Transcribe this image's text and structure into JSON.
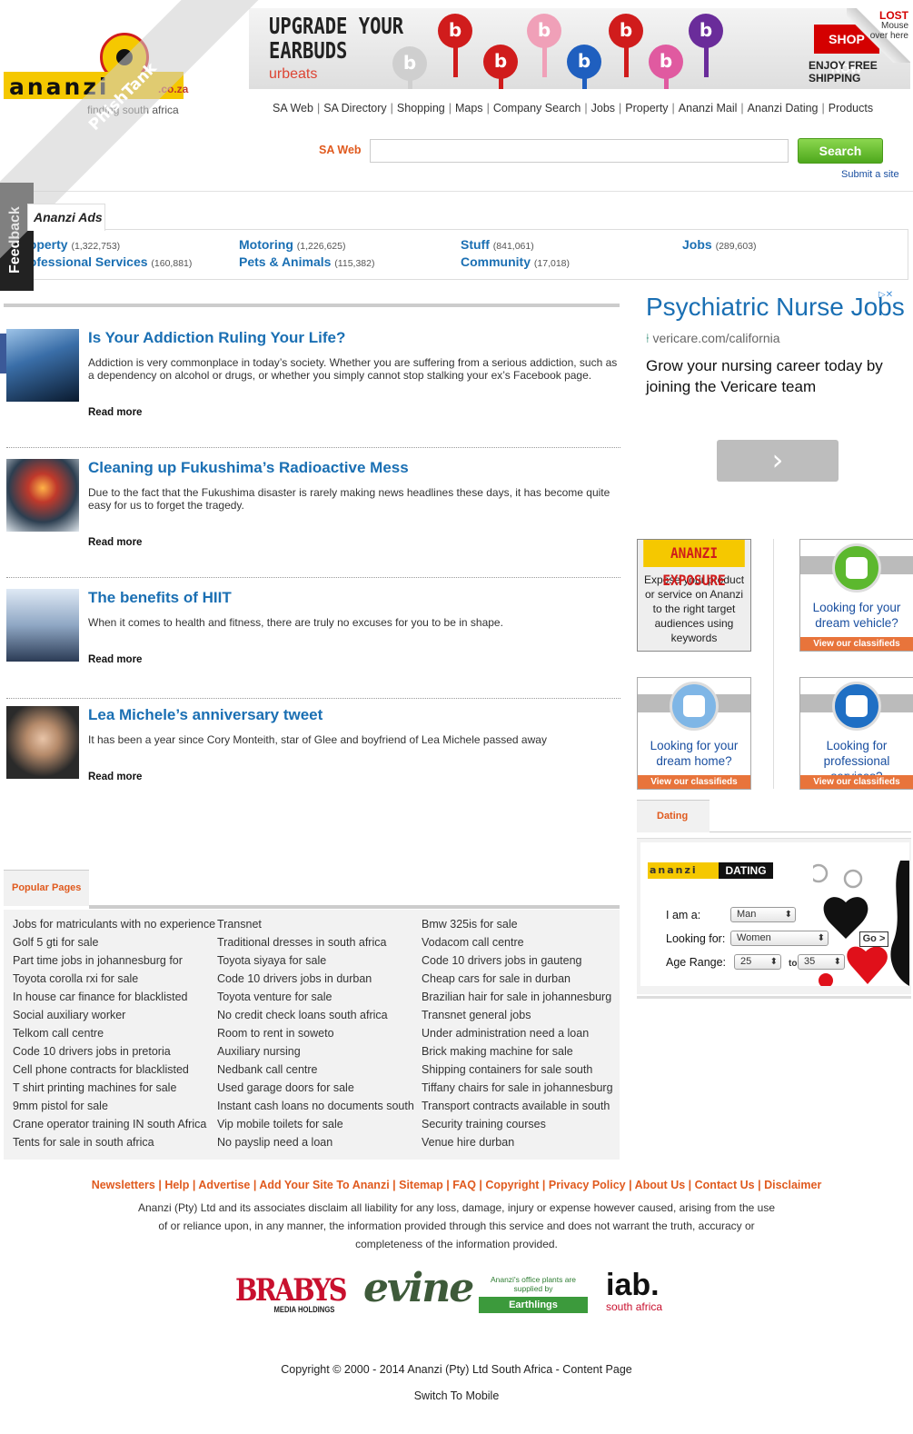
{
  "header": {
    "logo_text": "ananzi",
    "logo_domain": ".co.za",
    "tagline": "finding south africa",
    "banner": {
      "headline_line1": "UPGRADE YOUR",
      "headline_line2": "EARBUDS",
      "brand": "urbeats",
      "shop_now": "SHOP NOW",
      "free_shipping": "ENJOY FREE SHIPPING",
      "peel_title": "LOST",
      "peel_text": "Mouse over here",
      "bud_colors": [
        "#cfcfcf",
        "#d01c1c",
        "#d01c1c",
        "#f0a0b8",
        "#1f5fbf",
        "#d01c1c",
        "#e05aa0",
        "#6a2c9a"
      ]
    },
    "nav": [
      "SA Web",
      "SA Directory",
      "Shopping",
      "Maps",
      "Company Search",
      "Jobs",
      "Property",
      "Ananzi Mail",
      "Ananzi Dating",
      "Products"
    ],
    "search": {
      "label": "SA Web",
      "value": "",
      "placeholder": "",
      "button": "Search",
      "submit_link": "Submit a site"
    }
  },
  "feedback_label": "Feedback",
  "facebook_icon": "f",
  "watermark": "PhishTank",
  "ads": {
    "tab_label": "Ananzi Ads",
    "categories": [
      {
        "name": "Property",
        "count": "(1,322,753)"
      },
      {
        "name": "Professional Services",
        "count": "(160,881)"
      },
      {
        "name": "Motoring",
        "count": "(1,226,625)"
      },
      {
        "name": "Pets & Animals",
        "count": "(115,382)"
      },
      {
        "name": "Stuff",
        "count": "(841,061)"
      },
      {
        "name": "Community",
        "count": "(17,018)"
      },
      {
        "name": "Jobs",
        "count": "(289,603)"
      }
    ]
  },
  "articles": [
    {
      "title": "Is Your Addiction Ruling Your Life?",
      "text": "Addiction is very commonplace in today’s society. Whether you are suffering from a serious addiction, such as a dependency on alcohol or drugs, or whether you simply cannot stop stalking your ex’s Facebook page.",
      "more": "Read more"
    },
    {
      "title": "Cleaning up Fukushima’s Radioactive Mess",
      "text": "Due to the fact that the Fukushima disaster is rarely making news headlines these days, it has become quite easy for us to forget the tragedy.",
      "more": "Read more"
    },
    {
      "title": "The benefits of HIIT",
      "text": "When it comes to health and fitness, there are truly no excuses for you to be in shape.",
      "more": "Read more"
    },
    {
      "title": "Lea Michele’s anniversary tweet",
      "text": "It has been a year since Cory Monteith, star of Glee and boyfriend of Lea Michele passed away",
      "more": "Read more"
    }
  ],
  "sidebar_ad": {
    "title": "Psychiatric Nurse Jobs",
    "url": "vericare.com/california",
    "body": "Grow your nursing career today by joining the Vericare team",
    "arrow": "›",
    "adchoices": "▷✕"
  },
  "promos": {
    "exposure_title": "ANANZI EXPOSURE",
    "exposure_text": "Expose your product or service on Ananzi to the right target audiences using keywords",
    "vehicle": "Looking for your dream vehicle?",
    "home": "Looking for your dream home?",
    "services": "Looking for professional services?",
    "view": "View our classifieds"
  },
  "dating": {
    "tab": "Dating",
    "logo": "ananzi",
    "logo_badge": "DATING",
    "i_am": "I am a:",
    "i_am_value": "Man",
    "looking_for": "Looking for:",
    "looking_for_value": "Women",
    "go": "Go >",
    "age_range": "Age Range:",
    "age_from": "25",
    "to": "to",
    "age_to": "35"
  },
  "popular": {
    "tab": "Popular Pages",
    "col1": [
      "Jobs for matriculants with no experience",
      "Golf 5 gti for sale",
      "Part time jobs in johannesburg for",
      "Toyota corolla rxi for sale",
      "In house car finance for blacklisted",
      "Social auxiliary worker",
      "Telkom call centre",
      "Code 10 drivers jobs in pretoria",
      "Cell phone contracts for blacklisted",
      "T shirt printing machines for sale",
      "9mm pistol for sale",
      "Crane operator training IN south Africa",
      "Tents for sale in south africa"
    ],
    "col2": [
      "Transnet",
      "Traditional dresses in south africa",
      "Toyota siyaya for sale",
      "Code 10 drivers jobs in durban",
      "Toyota venture for sale",
      "No credit check loans south africa",
      "Room to rent in soweto",
      "Auxiliary nursing",
      "Nedbank call centre",
      "Used garage doors for sale",
      "Instant cash loans no documents south",
      "Vip mobile toilets for sale",
      "No payslip need a loan"
    ],
    "col3": [
      "Bmw 325is for sale",
      "Vodacom call centre",
      "Code 10 drivers jobs in gauteng",
      "Cheap cars for sale in durban",
      "Brazilian hair for sale in johannesburg",
      "Transnet general jobs",
      "Under administration need a loan",
      "Brick making machine for sale",
      "Shipping containers for sale south",
      "Tiffany chairs for sale in johannesburg",
      "Transport contracts available in south",
      "Security training courses",
      "Venue hire durban"
    ]
  },
  "footer": {
    "links": [
      "Newsletters",
      "Help",
      "Advertise",
      "Add Your Site To Ananzi",
      "Sitemap",
      "FAQ",
      "Copyright",
      "Privacy Policy",
      "About Us",
      "Contact Us",
      "Disclaimer"
    ],
    "disclaimer": "Ananzi (Pty) Ltd and its associates disclaim all liability for any loss, damage, injury or expense however caused, arising from the use of or reliance upon, in any manner, the information provided through this service and does not warrant the truth, accuracy or completeness of the information provided.",
    "brabys": "BRABYS",
    "brabys_sub": "MEDIA HOLDINGS",
    "evine": "evine",
    "earthlings_text": "Ananzi's office plants are supplied by",
    "earthlings": "Earthlings",
    "iab": "iab.",
    "iab_sub": "south africa",
    "copyright": "Copyright © 2000 - 2014 Ananzi (Pty) Ltd South Africa - Content Page",
    "switch": "Switch To Mobile"
  }
}
